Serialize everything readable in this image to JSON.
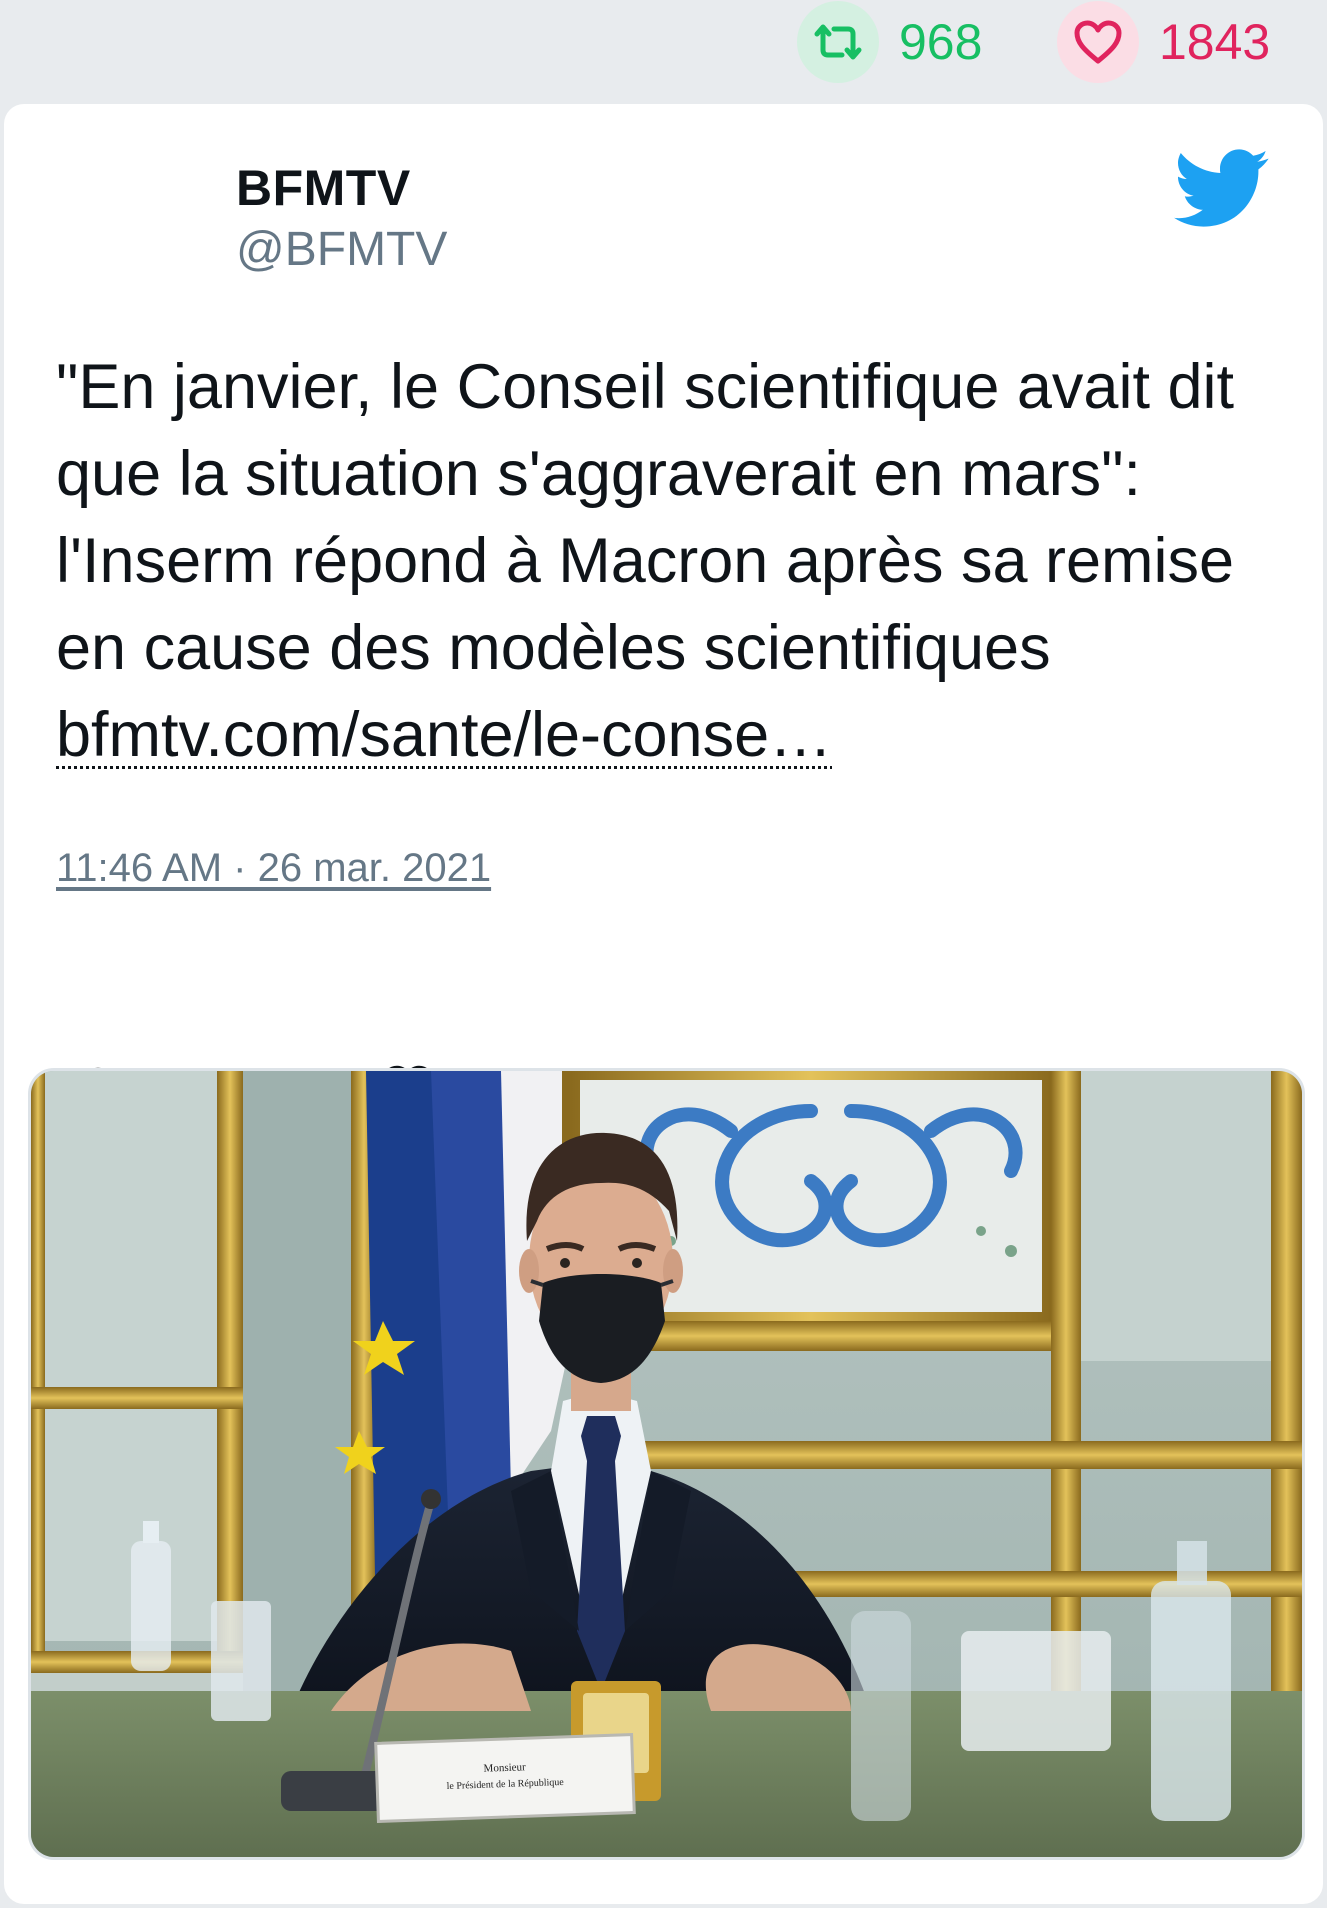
{
  "stats": {
    "retweet_count": "968",
    "like_count": "1843",
    "retweet_icon": "retweet-icon",
    "like_icon": "heart-icon",
    "retweet_color": "#17bf63",
    "like_color": "#e0245e"
  },
  "tweet": {
    "author_name": "BFMTV",
    "author_handle": "@BFMTV",
    "text": "\"En janvier, le Conseil scientifique avait dit que la situation s'aggraverait en mars\": l'Inserm répond à Macron après sa remise en cause des modèles scientifiques ",
    "link_text": "bfmtv.com/sante/le-conse…",
    "timestamp": "11:46 AM · 26 mar. 2021",
    "platform_icon": "twitter-bird-icon",
    "brand_color": "#1da1f2"
  },
  "actions": [
    {
      "icon": "reply-icon"
    },
    {
      "icon": "retweet-icon"
    },
    {
      "icon": "like-icon"
    }
  ],
  "media": {
    "name_plate_line1": "Monsieur",
    "name_plate_line2": "le Président de la République"
  }
}
